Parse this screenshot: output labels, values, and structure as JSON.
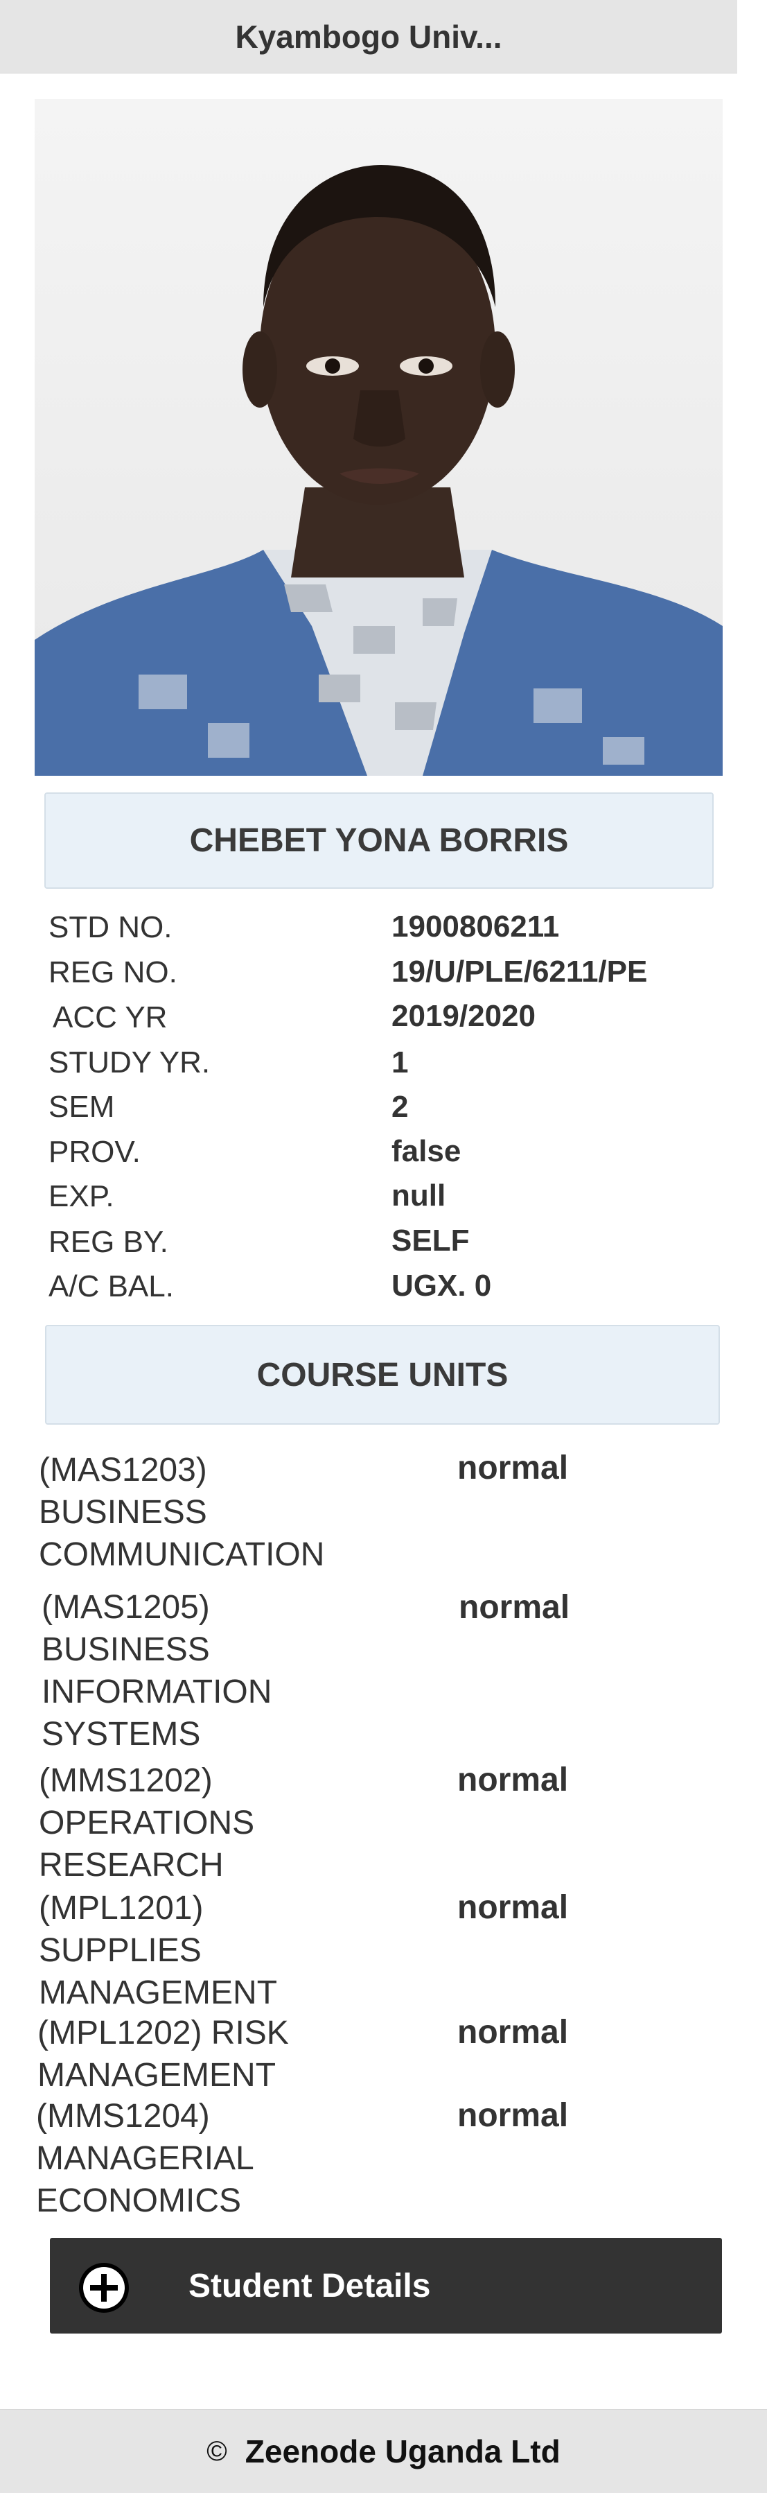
{
  "header": {
    "title": "Kyambogo Univ..."
  },
  "student": {
    "name": "CHEBET YONA BORRIS"
  },
  "details": [
    {
      "label": "STD NO.",
      "value": "1900806211"
    },
    {
      "label": "REG NO.",
      "value": "19/U/PLE/6211/PE"
    },
    {
      "label": "ACC YR",
      "value": "2019/2020"
    },
    {
      "label": "STUDY YR.",
      "value": "1"
    },
    {
      "label": "SEM",
      "value": "2"
    },
    {
      "label": "PROV.",
      "value": "false"
    },
    {
      "label": "EXP.",
      "value": "null"
    },
    {
      "label": "REG BY.",
      "value": "SELF"
    },
    {
      "label": "A/C BAL.",
      "value": "UGX. 0"
    }
  ],
  "course_units": {
    "heading": "COURSE UNITS",
    "items": [
      {
        "name": "(MAS1203) BUSINESS COMMUNICATION",
        "status": "normal"
      },
      {
        "name": "(MAS1205) BUSINESS INFORMATION SYSTEMS",
        "status": "normal"
      },
      {
        "name": "(MMS1202) OPERATIONS RESEARCH",
        "status": "normal"
      },
      {
        "name": "(MPL1201) SUPPLIES MANAGEMENT",
        "status": "normal"
      },
      {
        "name": "(MPL1202) RISK MANAGEMENT",
        "status": "normal"
      },
      {
        "name": "(MMS1204) MANAGERIAL ECONOMICS",
        "status": "normal"
      }
    ]
  },
  "actions": {
    "student_details_label": "Student Details",
    "icon": "plus-circle-icon"
  },
  "footer": {
    "copyright_symbol": "©",
    "company": "Zeenode Uganda Ltd"
  },
  "colors": {
    "button_bg": "#333333",
    "bar_bg": "#e9f1f8",
    "header_bg": "#e5e5e5"
  }
}
